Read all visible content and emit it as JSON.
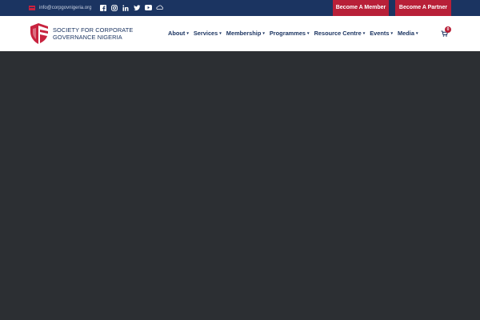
{
  "topbar": {
    "email": "info@corpgovnigeria.org",
    "socials": [
      "facebook-icon",
      "instagram-icon",
      "linkedin-icon",
      "twitter-icon",
      "youtube-icon",
      "soundcloud-icon"
    ],
    "buttons": {
      "member": "Become A Member",
      "partner": "Become A Partner"
    },
    "colors": {
      "bar": "#1b3461",
      "accent": "#b82038"
    }
  },
  "header": {
    "logo_line1": "SOCIETY FOR CORPORATE",
    "logo_line2": "GOVERNANCE NIGERIA",
    "nav": [
      {
        "label": "About"
      },
      {
        "label": "Services"
      },
      {
        "label": "Membership"
      },
      {
        "label": "Programmes"
      },
      {
        "label": "Resource Centre"
      },
      {
        "label": "Events"
      },
      {
        "label": "Media"
      }
    ],
    "cart_count": "0"
  },
  "hero": {
    "background": "#2c2f33"
  }
}
